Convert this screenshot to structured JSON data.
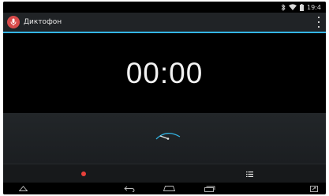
{
  "status_bar": {
    "time": "19:4",
    "icons": [
      "bluetooth-icon",
      "wifi-icon",
      "battery-icon"
    ]
  },
  "action_bar": {
    "app_icon": "microphone-icon",
    "title": "Диктофон",
    "overflow_icon": "overflow-menu-icon"
  },
  "timer": {
    "display": "00:00"
  },
  "level_meter": {
    "icon": "level-meter-icon",
    "accent_color": "#33b5e5"
  },
  "controls": {
    "record_icon": "record-icon",
    "record_color": "#e8403a",
    "list_icon": "recordings-list-icon"
  },
  "nav_bar": {
    "icons": [
      "home-up-icon",
      "back-icon",
      "home-icon",
      "recent-apps-icon",
      "fullscreen-icon"
    ]
  },
  "colors": {
    "accent": "#33b5e5",
    "actionbar_bg": "#202326",
    "background": "#000000"
  }
}
